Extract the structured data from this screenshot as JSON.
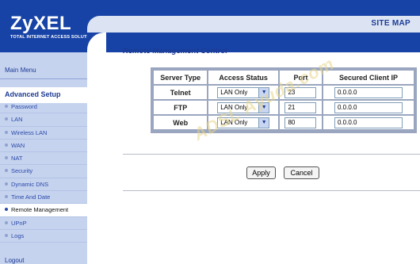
{
  "header": {
    "logo_text": "ZyXEL",
    "logo_tagline": "TOTAL INTERNET ACCESS SOLUTION",
    "site_map_label": "SITE MAP"
  },
  "sidebar": {
    "main_menu": "Main Menu",
    "section_title": "Advanced Setup",
    "items": [
      {
        "label": "Password",
        "active": false
      },
      {
        "label": "LAN",
        "active": false
      },
      {
        "label": "Wireless LAN",
        "active": false
      },
      {
        "label": "WAN",
        "active": false
      },
      {
        "label": "NAT",
        "active": false
      },
      {
        "label": "Security",
        "active": false
      },
      {
        "label": "Dynamic DNS",
        "active": false
      },
      {
        "label": "Time And Date",
        "active": false
      },
      {
        "label": "Remote Management",
        "active": true
      },
      {
        "label": "UPnP",
        "active": false
      },
      {
        "label": "Logs",
        "active": false
      }
    ],
    "logout": "Logout"
  },
  "main": {
    "title": "Remote Management Control",
    "columns": [
      "Server Type",
      "Access Status",
      "Port",
      "Secured Client IP"
    ],
    "rows": [
      {
        "service": "Telnet",
        "access": "LAN Only",
        "port": "23",
        "ip": "0.0.0.0"
      },
      {
        "service": "FTP",
        "access": "LAN Only",
        "port": "21",
        "ip": "0.0.0.0"
      },
      {
        "service": "Web",
        "access": "LAN Only",
        "port": "80",
        "ip": "0.0.0.0"
      }
    ],
    "apply_label": "Apply",
    "cancel_label": "Cancel",
    "dropdown_arrow": "▼"
  },
  "watermark": {
    "text": "ADSL Ayuda.com"
  },
  "colors": {
    "banner": "#1743a6",
    "sidebar": "#c6d3ef",
    "accent_text": "#1d3b94"
  }
}
